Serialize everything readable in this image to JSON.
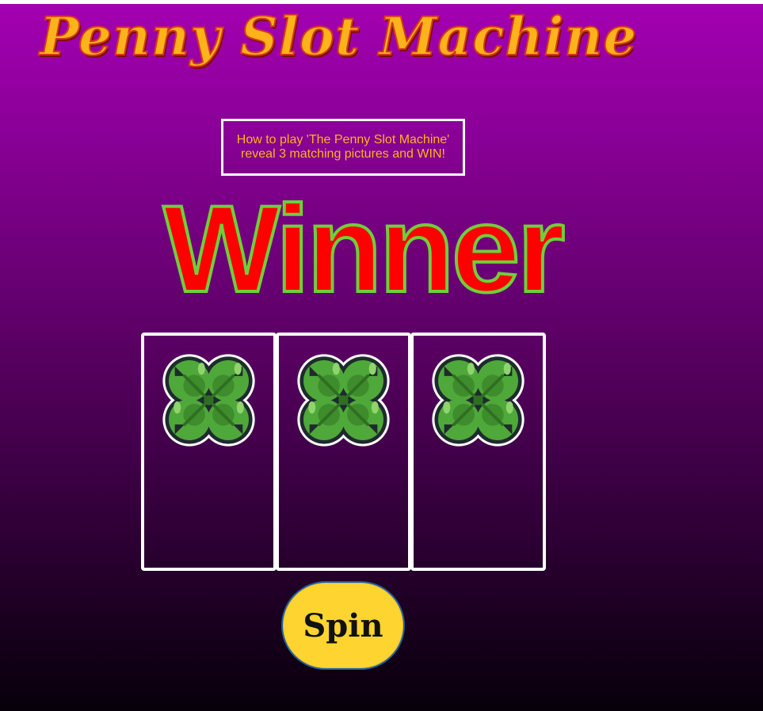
{
  "game": {
    "title": "Penny Slot Machine",
    "instructions": {
      "line1": "How to play 'The Penny Slot Machine'",
      "line2": "reveal 3 matching pictures and WIN!"
    },
    "result": "Winner",
    "reels": [
      {
        "symbol": "four-leaf-clover-icon"
      },
      {
        "symbol": "four-leaf-clover-icon"
      },
      {
        "symbol": "four-leaf-clover-icon"
      }
    ],
    "spin_label": "Spin"
  },
  "colors": {
    "title": "#ffb31a",
    "title_outline": "#d6351f",
    "winner": "#ff0000",
    "winner_outline": "#6fcf3a",
    "button": "#fdd430",
    "clover": "#4fa83a",
    "background_top": "#a300b1",
    "background_bottom": "#06000a"
  }
}
